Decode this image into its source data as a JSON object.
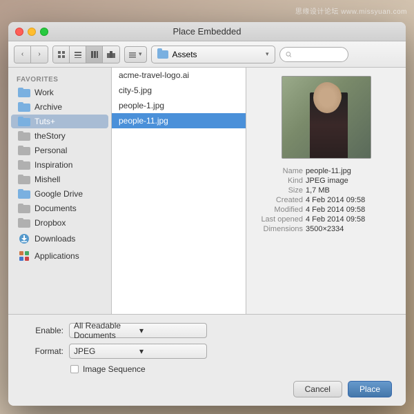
{
  "watermark": {
    "text1": "思缘设计论坛",
    "text2": "www.missyuan.com"
  },
  "dialog": {
    "title": "Place Embedded"
  },
  "toolbar": {
    "back_label": "‹",
    "forward_label": "›",
    "view_icon_grid": "⊞",
    "view_icon_list": "≡",
    "view_icon_col": "▦",
    "view_icon_cov": "▤",
    "view_dropdown_label": "▾",
    "location": "Assets",
    "search_placeholder": ""
  },
  "sidebar": {
    "section_label": "FAVORITES",
    "items": [
      {
        "label": "Work",
        "type": "folder",
        "active": false
      },
      {
        "label": "Archive",
        "type": "folder",
        "active": false
      },
      {
        "label": "Tuts+",
        "type": "folder",
        "active": true
      },
      {
        "label": "theStory",
        "type": "folder",
        "active": false
      },
      {
        "label": "Personal",
        "type": "folder",
        "active": false
      },
      {
        "label": "Inspiration",
        "type": "folder",
        "active": false
      },
      {
        "label": "Mishell",
        "type": "folder",
        "active": false
      },
      {
        "label": "Google Drive",
        "type": "folder",
        "active": false
      },
      {
        "label": "Documents",
        "type": "folder",
        "active": false
      },
      {
        "label": "Dropbox",
        "type": "folder",
        "active": false
      },
      {
        "label": "Downloads",
        "type": "download",
        "active": false
      },
      {
        "label": "Applications",
        "type": "app",
        "active": false
      }
    ]
  },
  "files": [
    {
      "name": "acme-travel-logo.ai",
      "selected": false
    },
    {
      "name": "city-5.jpg",
      "selected": false
    },
    {
      "name": "people-1.jpg",
      "selected": false
    },
    {
      "name": "people-11.jpg",
      "selected": true
    }
  ],
  "preview": {
    "name": "people-11.jpg",
    "kind": "JPEG image",
    "size": "1,7 MB",
    "created": "4 Feb 2014 09:58",
    "modified": "4 Feb 2014 09:58",
    "last_opened": "4 Feb 2014 09:58",
    "dimensions": "3500×2334"
  },
  "bottom": {
    "enable_label": "Enable:",
    "enable_value": "All Readable Documents",
    "format_label": "Format:",
    "format_value": "JPEG",
    "image_sequence_label": "Image Sequence",
    "cancel_label": "Cancel",
    "place_label": "Place"
  }
}
